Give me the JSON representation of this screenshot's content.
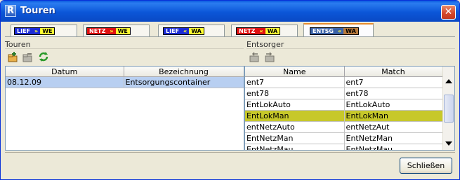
{
  "window": {
    "title": "Touren",
    "app_icon_letter": "R",
    "close_glyph": "✕"
  },
  "tabs": [
    {
      "from": "LIEF",
      "arrow": "»",
      "to": "WE",
      "active": false,
      "from_bg": "#1a2ad6",
      "from_fg": "#ffffff",
      "to_bg": "#ffff33",
      "to_fg": "#000000",
      "direction": "right"
    },
    {
      "from": "NETZ",
      "arrow": "»",
      "to": "WE",
      "active": false,
      "from_bg": "#e01010",
      "from_fg": "#ffffff",
      "to_bg": "#ffff33",
      "to_fg": "#000000",
      "direction": "right"
    },
    {
      "from": "LIEF",
      "arrow": "«",
      "to": "WA",
      "active": false,
      "from_bg": "#1a2ad6",
      "from_fg": "#ffffff",
      "to_bg": "#ffff33",
      "to_fg": "#000000",
      "direction": "left"
    },
    {
      "from": "NETZ",
      "arrow": "«",
      "to": "WA",
      "active": false,
      "from_bg": "#e01010",
      "from_fg": "#ffffff",
      "to_bg": "#ffff33",
      "to_fg": "#000000",
      "direction": "left"
    },
    {
      "from": "ENTSG",
      "arrow": "«",
      "to": "WA",
      "active": true,
      "from_bg": "#3a62a8",
      "from_fg": "#ffffff",
      "to_bg": "#b87a3c",
      "to_fg": "#000000",
      "direction": "left"
    }
  ],
  "left_pane": {
    "title": "Touren",
    "toolbar": [
      "add-icon",
      "remove-icon",
      "refresh-icon"
    ],
    "columns": [
      "Datum",
      "Bezeichnung"
    ],
    "rows": [
      {
        "datum": "08.12.09",
        "bezeichnung": "Entsorgungscontainer",
        "selected": true
      }
    ]
  },
  "right_pane": {
    "title": "Entsorger",
    "toolbar": [
      "move-left-icon",
      "move-right-icon"
    ],
    "columns": [
      "Name",
      "Match"
    ],
    "rows": [
      {
        "name": "ent7",
        "match": "ent7",
        "selected": false
      },
      {
        "name": "ent78",
        "match": "ent78",
        "selected": false
      },
      {
        "name": "EntLokAuto",
        "match": "EntLokAuto",
        "selected": false
      },
      {
        "name": "EntLokMan",
        "match": "EntLokMan",
        "selected": true
      },
      {
        "name": "entNetzAuto",
        "match": "entNetzAut",
        "selected": false
      },
      {
        "name": "EntNetzMan",
        "match": "EntNetzMan",
        "selected": false
      },
      {
        "name": "EntNetzMau",
        "match": "EntNetzMau",
        "selected": false
      }
    ]
  },
  "buttons": {
    "close_label": "Schließen"
  },
  "colors": {
    "title_bar": "#0a5be0",
    "selection_blue": "#b8cff1",
    "selection_yellow": "#c7c82a",
    "active_tab_accent": "#e68b2c"
  }
}
